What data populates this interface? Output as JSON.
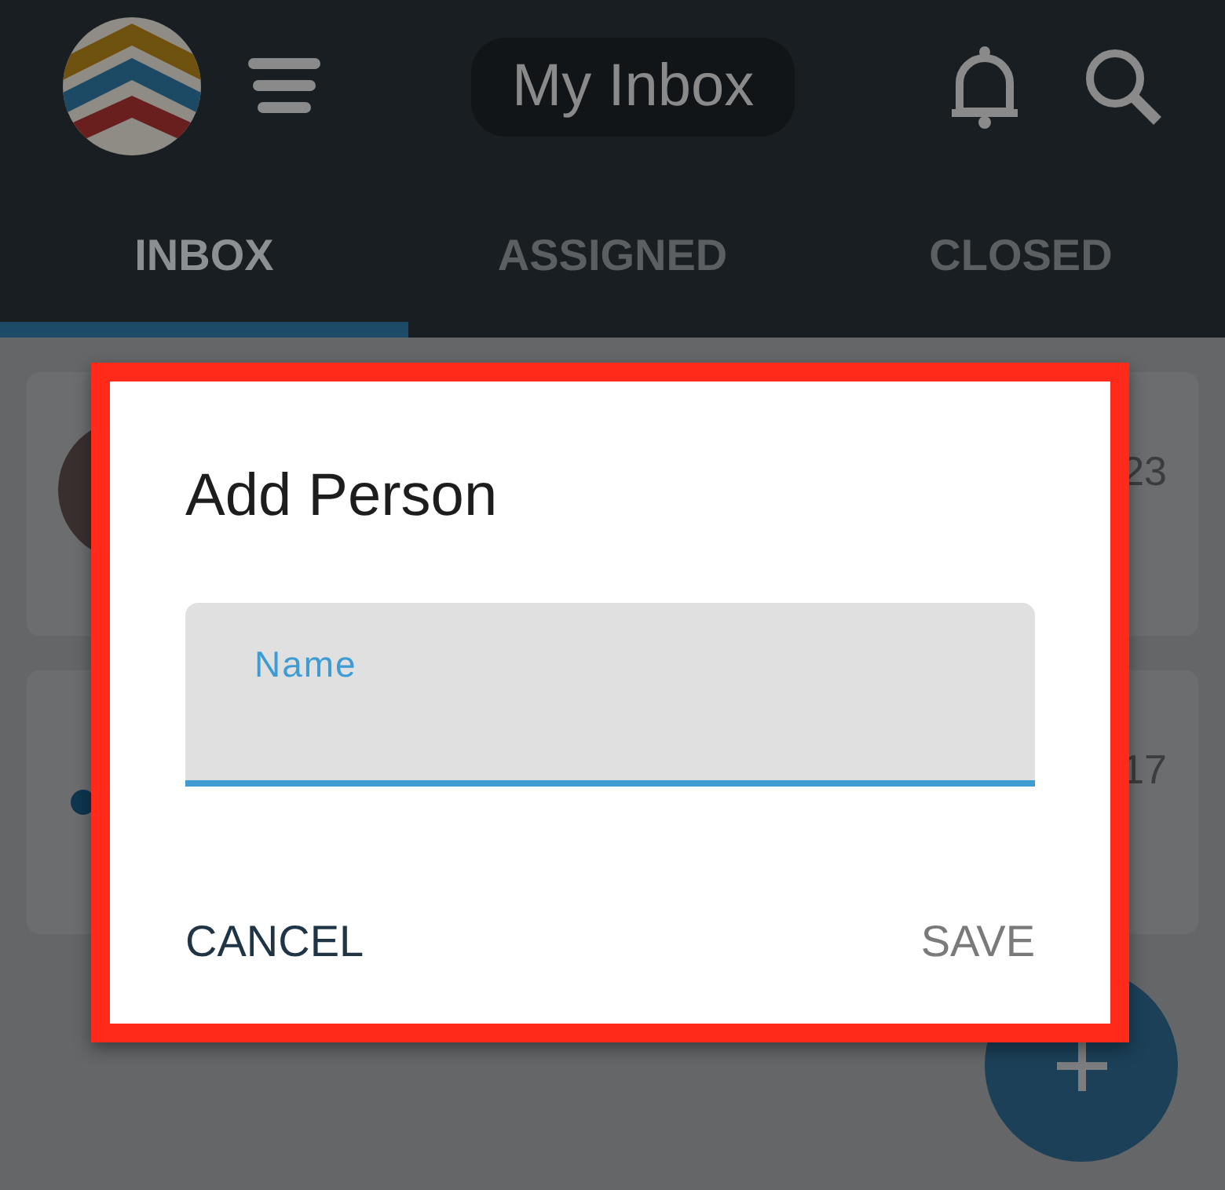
{
  "header": {
    "title": "My Inbox"
  },
  "tabs": [
    {
      "label": "INBOX",
      "selected": true
    },
    {
      "label": "ASSIGNED",
      "selected": false
    },
    {
      "label": "CLOSED",
      "selected": false
    }
  ],
  "cards": [
    {
      "kind": "avatar",
      "time": "23"
    },
    {
      "kind": "dot",
      "time": "17"
    }
  ],
  "dialog": {
    "title": "Add Person",
    "field": {
      "placeholder": "Name"
    },
    "buttons": [
      {
        "label": "CANCEL",
        "disabled": false
      },
      {
        "label": "SAVE",
        "disabled": true
      }
    ]
  }
}
